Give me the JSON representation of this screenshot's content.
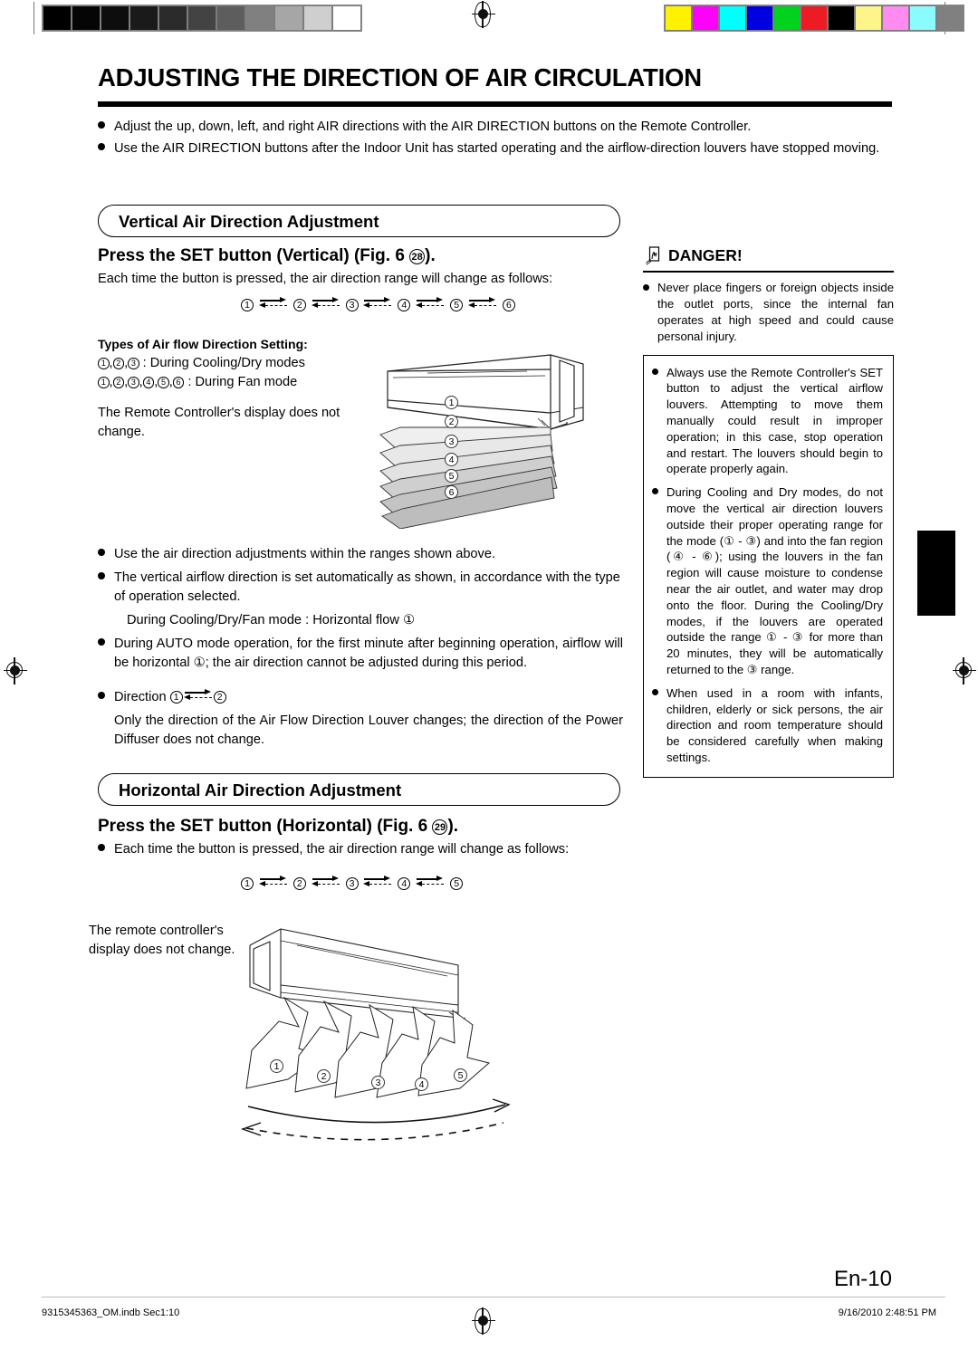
{
  "print_strip": {
    "gray_wedge": [
      "#000000",
      "#050505",
      "#0d0d0d",
      "#1a1a1a",
      "#2b2b2b",
      "#434343",
      "#5d5d5d",
      "#808080",
      "#a6a6a6",
      "#cfcfcf",
      "#ffffff"
    ],
    "color_wedge": [
      "#fff200",
      "#ff00ff",
      "#00ffff",
      "#0000e0",
      "#00d21e",
      "#ed1c24",
      "#000000",
      "#fdf48a",
      "#ff8af0",
      "#8afbff",
      "#808080"
    ],
    "registration_icon": "registration-target-icon"
  },
  "header": {
    "title": "ADJUSTING THE DIRECTION OF AIR CIRCULATION",
    "intro_bullets": [
      "Adjust the up, down, left, and right AIR directions with the AIR DIRECTION buttons on the Remote Controller.",
      "Use the AIR DIRECTION buttons after the Indoor Unit has started operating and the airflow-direction louvers have stopped moving."
    ]
  },
  "vertical": {
    "section_title": "Vertical Air Direction Adjustment",
    "subhead_prefix": "Press the SET button (Vertical) (Fig. 6 ",
    "subhead_figure_num": "28",
    "subhead_suffix": ").",
    "lead_text": "Each time the button is pressed, the air direction range will change as follows:",
    "sequence": [
      "1",
      "2",
      "3",
      "4",
      "5",
      "6"
    ],
    "types_title": "Types of Air flow Direction Setting:",
    "types_line1_nums": [
      "1",
      "2",
      "3"
    ],
    "types_line1_text": " : During Cooling/Dry modes",
    "types_line2_nums": [
      "1",
      "2",
      "3",
      "4",
      "5",
      "6"
    ],
    "types_line2_text": " : During Fan mode",
    "remote_note": "The Remote Controller's display does not change.",
    "diagram_labels": [
      "1",
      "2",
      "3",
      "4",
      "5",
      "6"
    ],
    "bullets": [
      "Use the air direction adjustments within the ranges shown above.",
      "The vertical airflow direction is set automatically as shown, in accordance with the type of operation selected.",
      "During AUTO mode operation, for the first minute after beginning operation, airflow will be horizontal ①; the air direction cannot be adjusted during this period.",
      "Direction ① ⇄ ②"
    ],
    "sub_note": "During Cooling/Dry/Fan mode : Horizontal flow ①",
    "direction_label": "Direction",
    "direction_a": "1",
    "direction_b": "2",
    "direction_note": "Only the direction of the Air Flow Direction Louver changes; the direction of the Power Diffuser does not change."
  },
  "danger": {
    "heading": "DANGER!",
    "icon": "hand-warning-icon",
    "top_bullet": "Never place fingers or foreign objects inside the outlet ports, since the internal fan operates at high speed and could cause personal injury.",
    "boxed_bullets": [
      "Always use the Remote Controller's SET button to adjust the vertical airflow louvers. Attempting to move them manually could result in improper operation; in this case, stop operation and restart. The louvers should begin to operate properly again.",
      "During Cooling and Dry modes, do not move the vertical air direction louvers outside their proper operating range for the mode (① - ③) and into the fan region (④ - ⑥); using the louvers in the fan region will cause moisture to condense near the air outlet, and water may drop onto the floor. During the Cooling/Dry modes, if the louvers are operated outside the range ① - ③ for more than 20 minutes, they will be automatically returned to the ③ range.",
      "When used in a room with infants, children, elderly or sick persons, the air direction and room temperature should be considered carefully when making settings."
    ]
  },
  "horizontal": {
    "section_title": "Horizontal Air Direction Adjustment",
    "subhead_prefix": "Press the SET button (Horizontal) (Fig. 6 ",
    "subhead_figure_num": "29",
    "subhead_suffix": ").",
    "lead_bullet": "Each time the button is pressed, the air direction range will change as follows:",
    "sequence": [
      "1",
      "2",
      "3",
      "4",
      "5"
    ],
    "remote_note_line1": "The remote controller's",
    "remote_note_line2": "display does not change.",
    "diagram_labels": [
      "1",
      "2",
      "3",
      "4",
      "5"
    ]
  },
  "footer": {
    "page_number": "En-10",
    "file_label": "9315345363_OM.indb   Sec1:10",
    "timestamp": "9/16/2010   2:48:51 PM"
  }
}
